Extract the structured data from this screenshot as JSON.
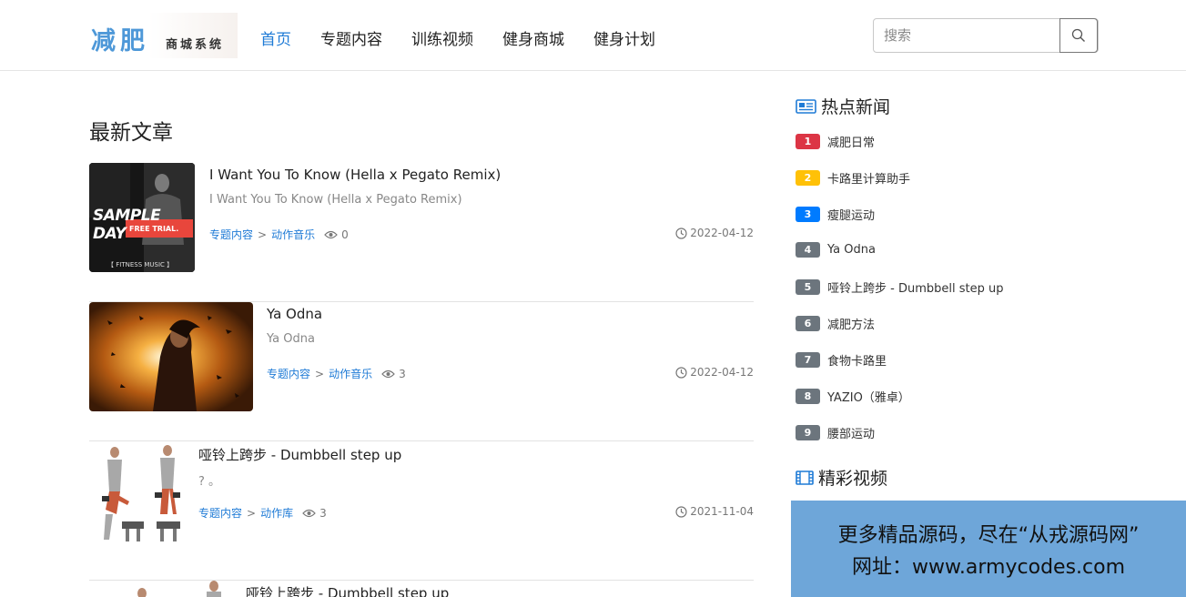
{
  "header": {
    "logo_main": "减肥",
    "logo_sub": "商城系统",
    "nav": [
      {
        "label": "首页",
        "active": true
      },
      {
        "label": "专题内容"
      },
      {
        "label": "训练视频"
      },
      {
        "label": "健身商城"
      },
      {
        "label": "健身计划"
      }
    ],
    "search_placeholder": "搜索"
  },
  "main": {
    "section_title": "最新文章",
    "articles": [
      {
        "title": "I Want You To Know (Hella x Pegato Remix)",
        "desc": "I Want You To Know (Hella x Pegato Remix)",
        "category": "专题内容",
        "subcategory": "动作音乐",
        "separator": ">",
        "views": "0",
        "date": "2022-04-12",
        "thumb_text_main": "SAMPLE DAY",
        "thumb_text_sub": "FREE TRIAL.",
        "thumb_caption": "【 FITNESS MUSIC 】"
      },
      {
        "title": "Ya Odna",
        "desc": "Ya Odna",
        "category": "专题内容",
        "subcategory": "动作音乐",
        "separator": ">",
        "views": "3",
        "date": "2022-04-12"
      },
      {
        "title": "哑铃上跨步 - Dumbbell step up",
        "desc": "? 。",
        "category": "专题内容",
        "subcategory": "动作库",
        "separator": ">",
        "views": "3",
        "date": "2021-11-04"
      },
      {
        "title": "哑铃上跨步 - Dumbbell step up"
      }
    ]
  },
  "sidebar": {
    "hot_news_title": "热点新闻",
    "hot_news": [
      {
        "rank": "1",
        "label": "减肥日常",
        "color": "#dc3545"
      },
      {
        "rank": "2",
        "label": "卡路里计算助手",
        "color": "#ffc107"
      },
      {
        "rank": "3",
        "label": "瘦腿运动",
        "color": "#007bff"
      },
      {
        "rank": "4",
        "label": "Ya Odna",
        "color": "#6c757d"
      },
      {
        "rank": "5",
        "label": "哑铃上跨步 - Dumbbell step up",
        "color": "#6c757d"
      },
      {
        "rank": "6",
        "label": "减肥方法",
        "color": "#6c757d"
      },
      {
        "rank": "7",
        "label": "食物卡路里",
        "color": "#6c757d"
      },
      {
        "rank": "8",
        "label": "YAZIO（雅卓）",
        "color": "#6c757d"
      },
      {
        "rank": "9",
        "label": "腰部运动",
        "color": "#6c757d"
      }
    ],
    "video_title": "精彩视频"
  },
  "watermark": {
    "line1": "更多精品源码，尽在“从戎源码网”",
    "line2": "网址：www.armycodes.com"
  },
  "colors": {
    "accent": "#1f7bd6",
    "icon_blue": "#1f7bd6",
    "watermark_bg": "#6ea6d9"
  },
  "icons": {
    "search": "search-icon",
    "views": "eye-icon",
    "date": "clock-icon",
    "news": "newspaper-icon",
    "video": "film-icon"
  }
}
